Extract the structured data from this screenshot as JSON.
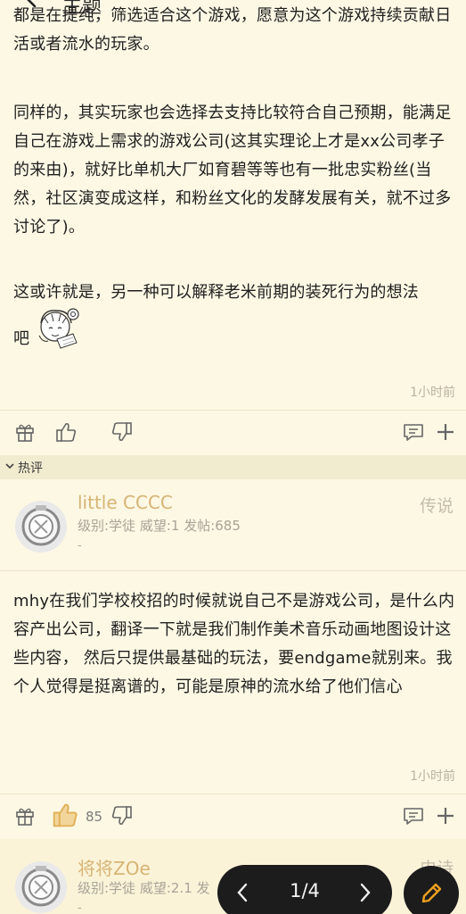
{
  "topbar": {
    "title": "主题"
  },
  "post": {
    "paragraphs": [
      "都是在提纯，筛选适合这个游戏，愿意为这个游戏持续贡献日活或者流水的玩家。",
      "同样的，其实玩家也会选择去支持比较符合自己预期，能满足自己在游戏上需求的游戏公司(这其实理论上才是xx公司孝子的来由)，就好比单机大厂如育碧等等也有一批忠实粉丝(当然，社区演变成这样，和粉丝文化的发酵发展有关，就不过多讨论了)。",
      "这或许就是，另一种可以解释老米前期的装死行为的想法",
      "吧"
    ],
    "timestamp": "1小时前"
  },
  "section": {
    "label": "热评"
  },
  "comments": [
    {
      "username": "little CCCC",
      "meta": "级别:学徒 威望:1 发帖:685",
      "dash": "-",
      "rank": "传说",
      "text": "mhy在我们学校校招的时候就说自己不是游戏公司，是什么内容产出公司，翻译一下就是我们制作美术音乐动画地图设计这些内容， 然后只提供最基础的玩法，要endgame就别来。我个人觉得是挺离谱的，可能是原神的流水给了他们信心",
      "timestamp": "1小时前",
      "likes": "85"
    },
    {
      "username": "将将ZOe",
      "meta": "级别:学徒 威望:2.1 发",
      "dash": "-",
      "rank": "史诗"
    }
  ],
  "pager": {
    "text": "1/4"
  },
  "icons": {
    "gift": "gift-icon",
    "like": "thumbs-up-icon",
    "dislike": "thumbs-down-icon",
    "comment": "comment-icon",
    "more": "plus-icon",
    "edit": "pencil-icon"
  },
  "colors": {
    "background": "#fdf8e4",
    "username": "#d7b474",
    "like_active": "#e0b25a",
    "pager_bg": "#1c1c1c",
    "edit_accent": "#f0a020"
  }
}
